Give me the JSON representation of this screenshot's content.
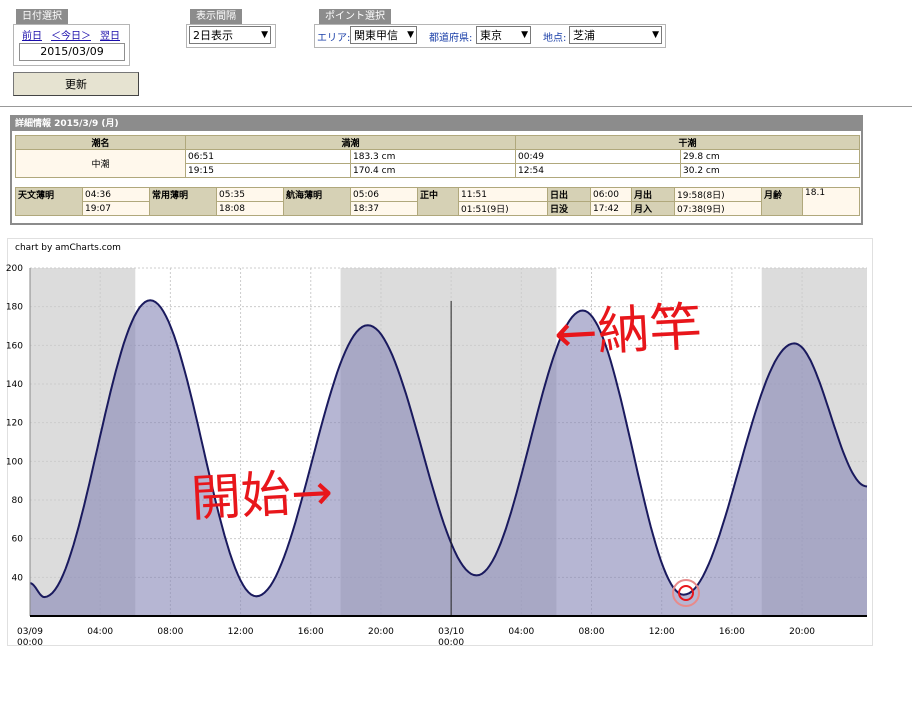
{
  "date_select": {
    "title": "日付選択",
    "prev": "前日",
    "today": "＜今日＞",
    "next": "翌日",
    "date": "2015/03/09"
  },
  "interval_select": {
    "title": "表示間隔",
    "value": "2日表示"
  },
  "point_select": {
    "title": "ポイント選択",
    "area_label": "エリア:",
    "area_value": "関東甲信",
    "pref_label": "都道府県:",
    "pref_value": "東京",
    "point_label": "地点:",
    "point_value": "芝浦"
  },
  "update_button": "更新",
  "detail": {
    "title": "詳細情報  2015/3/9 (月)",
    "headers": {
      "tide_name": "潮名",
      "high": "満潮",
      "low": "干潮"
    },
    "tide_name": "中潮",
    "high_rows": [
      {
        "time": "06:51",
        "level": "183.3 cm"
      },
      {
        "time": "19:15",
        "level": "170.4 cm"
      }
    ],
    "low_rows": [
      {
        "time": "00:49",
        "level": "29.8 cm"
      },
      {
        "time": "12:54",
        "level": "30.2 cm"
      }
    ],
    "astro": {
      "twilight_astro_label": "天文薄明",
      "twilight_astro": [
        "04:36",
        "19:07"
      ],
      "twilight_civil_label": "常用薄明",
      "twilight_civil": [
        "05:35",
        "18:08"
      ],
      "twilight_nautical_label": "航海薄明",
      "twilight_nautical": [
        "05:06",
        "18:37"
      ],
      "noon_label": "正中",
      "noon": [
        "11:51",
        "01:51(9日)"
      ],
      "sunrise_label": "日出",
      "sunrise": "06:00",
      "sunset_label": "日没",
      "sunset": "17:42",
      "moonrise_label": "月出",
      "moonrise": "19:58(8日)",
      "moonset_label": "月入",
      "moonset": "07:38(9日)",
      "moon_age_label": "月齢",
      "moon_age": "18.1"
    }
  },
  "chart_credit": "chart by amCharts.com",
  "chart_data": {
    "type": "area",
    "x_unit": "hours since 2015/03/09 00:00",
    "x_ticks": [
      {
        "t": 0,
        "label": "03/09",
        "sub": "00:00"
      },
      {
        "t": 4,
        "label": "04:00"
      },
      {
        "t": 8,
        "label": "08:00"
      },
      {
        "t": 12,
        "label": "12:00"
      },
      {
        "t": 16,
        "label": "16:00"
      },
      {
        "t": 20,
        "label": "20:00"
      },
      {
        "t": 24,
        "label": "03/10",
        "sub": "00:00"
      },
      {
        "t": 28,
        "label": "04:00"
      },
      {
        "t": 32,
        "label": "08:00"
      },
      {
        "t": 36,
        "label": "12:00"
      },
      {
        "t": 40,
        "label": "16:00"
      },
      {
        "t": 44,
        "label": "20:00"
      }
    ],
    "xlim": [
      0,
      47.7
    ],
    "ylim": [
      20,
      200
    ],
    "y_ticks": [
      40,
      60,
      80,
      100,
      120,
      140,
      160,
      180,
      200
    ],
    "series": [
      {
        "values": [
          [
            0,
            37
          ],
          [
            0.82,
            29.8
          ],
          [
            6.85,
            183.3
          ],
          [
            12.9,
            30.2
          ],
          [
            19.25,
            170.4
          ],
          [
            25.45,
            41
          ],
          [
            31.5,
            178
          ],
          [
            37.25,
            31
          ],
          [
            43.55,
            161
          ],
          [
            47.7,
            87
          ]
        ]
      }
    ],
    "night_bands": [
      [
        0,
        6.0
      ],
      [
        17.7,
        30.0
      ],
      [
        41.7,
        47.7
      ]
    ],
    "line_color": "#1a1a5e",
    "fill_color": "#8585b5",
    "now_marker": 24,
    "annotations": [
      {
        "text": "開始→",
        "color": "#e8161b"
      },
      {
        "text": "←納竿",
        "color": "#e8161b"
      }
    ]
  }
}
